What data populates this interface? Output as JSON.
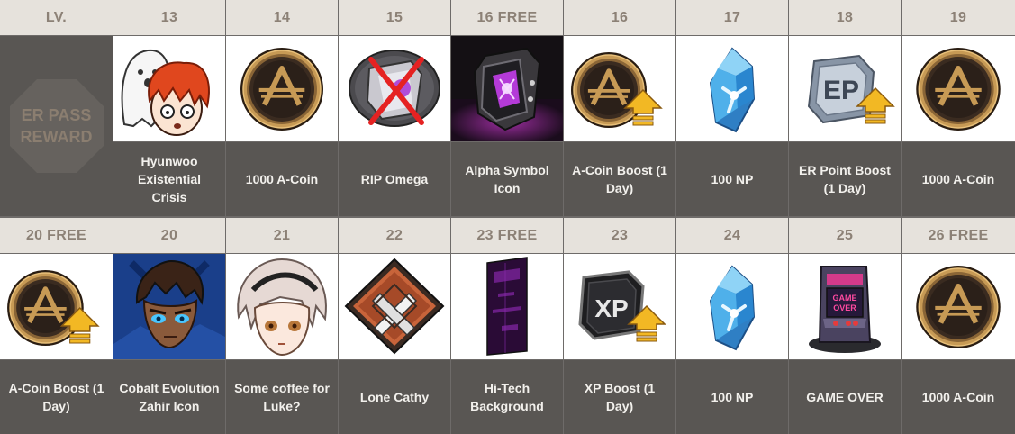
{
  "header_label": "LV.",
  "side_label": [
    "ER PASS",
    "REWARD"
  ],
  "row1": [
    {
      "level": "13",
      "reward": "Hyunwoo Existential Crisis",
      "icon": "hyunwoo-emote-icon"
    },
    {
      "level": "14",
      "reward": "1000 A-Coin",
      "icon": "a-coin-icon"
    },
    {
      "level": "15",
      "reward": "RIP Omega",
      "icon": "rip-omega-icon"
    },
    {
      "level": "16 FREE",
      "reward": "Alpha Symbol Icon",
      "icon": "alpha-symbol-icon"
    },
    {
      "level": "16",
      "reward": "A-Coin Boost (1 Day)",
      "icon": "a-coin-boost-icon"
    },
    {
      "level": "17",
      "reward": "100 NP",
      "icon": "np-crystal-icon"
    },
    {
      "level": "18",
      "reward": "ER Point Boost (1 Day)",
      "icon": "ep-boost-icon"
    },
    {
      "level": "19",
      "reward": "1000 A-Coin",
      "icon": "a-coin-icon"
    }
  ],
  "row2": [
    {
      "level": "20 FREE",
      "reward": "A-Coin Boost (1 Day)",
      "icon": "a-coin-boost-icon"
    },
    {
      "level": "20",
      "reward": "Cobalt Evolution Zahir Icon",
      "icon": "zahir-portrait-icon"
    },
    {
      "level": "21",
      "reward": "Some coffee for Luke?",
      "icon": "luke-emote-icon"
    },
    {
      "level": "22",
      "reward": "Lone Cathy",
      "icon": "lone-cathy-icon"
    },
    {
      "level": "23 FREE",
      "reward": "Hi-Tech Background",
      "icon": "hi-tech-background-icon"
    },
    {
      "level": "23",
      "reward": "XP Boost (1 Day)",
      "icon": "xp-boost-icon"
    },
    {
      "level": "24",
      "reward": "100 NP",
      "icon": "np-crystal-icon"
    },
    {
      "level": "25",
      "reward": "GAME OVER",
      "icon": "game-over-arcade-icon"
    },
    {
      "level": "26 FREE",
      "reward": "1000 A-Coin",
      "icon": "a-coin-icon"
    }
  ],
  "icon_text": {
    "ep": "EP",
    "xp": "XP",
    "game_over": [
      "GAME",
      "OVER"
    ]
  },
  "colors": {
    "header_bg": "#e6e2dc",
    "header_text": "#8c8176",
    "label_bg": "#595653",
    "label_text": "#f2f0ec",
    "coin_gold": "#c79a55",
    "boost_arrow": "#f2b824",
    "np_blue": "#3fa2e0"
  }
}
